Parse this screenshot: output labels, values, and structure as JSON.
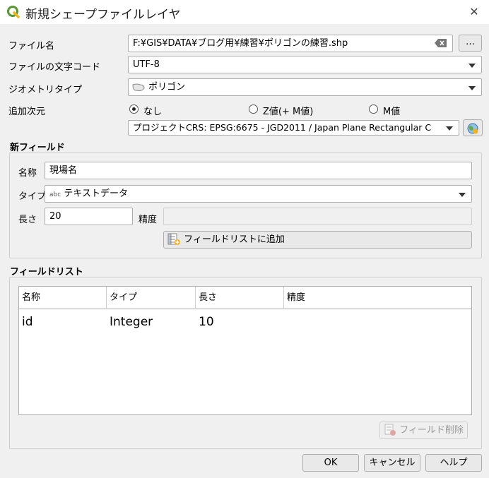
{
  "window": {
    "title": "新規シェープファイルレイヤ"
  },
  "form": {
    "filename_label": "ファイル名",
    "filename_value": "F:¥GIS¥DATA¥ブログ用¥練習¥ポリゴンの練習.shp",
    "browse_label": "…",
    "encoding_label": "ファイルの文字コード",
    "encoding_value": "UTF-8",
    "geometry_label": "ジオメトリタイプ",
    "geometry_value": "ポリゴン",
    "dimensions_label": "追加次元",
    "dim_options": [
      "なし",
      "Z値(+ M値)",
      "M値"
    ],
    "crs_value": "プロジェクトCRS: EPSG:6675 - JGD2011 / Japan Plane Rectangular C"
  },
  "new_field": {
    "section_title": "新フィールド",
    "name_label": "名称",
    "name_value": "現場名",
    "type_label": "タイプ",
    "type_badge": "abc",
    "type_value": "テキストデータ",
    "length_label": "長さ",
    "length_value": "20",
    "precision_label": "精度",
    "precision_value": "",
    "add_button": "フィールドリストに追加"
  },
  "field_list": {
    "section_title": "フィールドリスト",
    "columns": [
      "名称",
      "タイプ",
      "長さ",
      "精度"
    ],
    "rows": [
      {
        "name": "id",
        "type": "Integer",
        "length": "10",
        "precision": ""
      }
    ],
    "delete_button": "フィールド削除"
  },
  "buttons": {
    "ok": "OK",
    "cancel": "キャンセル",
    "help": "ヘルプ"
  },
  "colors": {
    "qgis_green": "#589632",
    "qgis_yellow": "#f0b323"
  }
}
